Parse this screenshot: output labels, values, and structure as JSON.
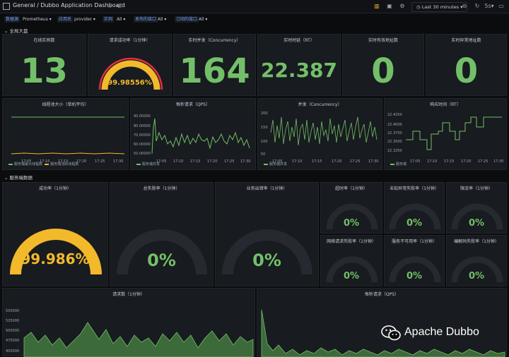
{
  "header": {
    "breadcrumb_root": "General",
    "breadcrumb_sep": "/",
    "title": "Dubbo Application Dashboard",
    "time_range": "Last 30 minutes",
    "refresh": "5s"
  },
  "variables": [
    {
      "label": "数据源",
      "value": "Prometheus ▾"
    },
    {
      "label": "应用名",
      "value": "provider ▾"
    },
    {
      "label": "实例",
      "value": "All ▾"
    },
    {
      "label": "发布的接口",
      "value": "All ▾"
    },
    {
      "label": "订阅的接口",
      "value": "All ▾"
    }
  ],
  "rows": {
    "global": "⌄ 全局大盘",
    "server": "⌄ 服务端数据"
  },
  "stats": {
    "online": {
      "title": "在线实例数",
      "value": "13"
    },
    "success_gauge": {
      "title": "请求成功率（1分钟）",
      "value": "99.98556%",
      "percent": 99.98556
    },
    "concurrency": {
      "title": "实时并发（Concurrency）",
      "value": "164"
    },
    "rt": {
      "title": "实时时延（RT）",
      "value": "22.387"
    },
    "valid_addr": {
      "title": "实时有效地址数",
      "value": "0"
    },
    "invalid_addr": {
      "title": "实时异常地址数",
      "value": "0"
    }
  },
  "timeseries": {
    "thread_pool": {
      "title": "线程池大小（单机平均）",
      "x_ticks": [
        "17:05",
        "17:10",
        "17:15",
        "17:20",
        "17:25",
        "17:30"
      ],
      "legend": [
        "服务端最大线程数",
        "服务端活跃线程数"
      ]
    },
    "qps": {
      "title": "每秒请求（QPS）",
      "y_ticks": [
        "90.00000",
        "80.00000",
        "70.00000",
        "60.00000",
        "50.00000"
      ],
      "x_ticks": [
        "17:05",
        "17:10",
        "17:15",
        "17:20",
        "17:25",
        "17:30"
      ],
      "legend": [
        "服务端并发"
      ]
    },
    "concurrency": {
      "title": "并发（Concurrency）",
      "y_ticks": [
        "200",
        "150",
        "100",
        "50"
      ],
      "x_ticks": [
        "17:05",
        "17:10",
        "17:15",
        "17:20",
        "17:25",
        "17:30"
      ],
      "legend": [
        "服务端并发"
      ]
    },
    "response_time": {
      "title": "响应时间（RT）",
      "y_ticks": [
        "22.4250",
        "22.4000",
        "22.3750",
        "22.3500",
        "22.3250"
      ],
      "x_ticks": [
        "17:05",
        "17:10",
        "17:15",
        "17:20",
        "17:25",
        "17:30"
      ],
      "legend": [
        "服务端"
      ]
    }
  },
  "server_gauges": {
    "success": {
      "title": "成功率（1分钟）",
      "value": "99.986%",
      "percent": 99.986
    },
    "total_fail": {
      "title": "总失败率（1分钟）",
      "value": "0%",
      "percent": 0
    },
    "biz_fail": {
      "title": "业务出错率（1分钟）",
      "value": "0%",
      "percent": 0
    },
    "timeout": {
      "title": "超时率（1分钟）",
      "value": "0%",
      "percent": 0
    },
    "unknown": {
      "title": "未知异常失败率（1分钟）",
      "value": "0%",
      "percent": 0
    },
    "limit": {
      "title": "限流率（1分钟）",
      "value": "0%",
      "percent": 0
    },
    "network": {
      "title": "网络请求失败率（1分钟）",
      "value": "0%",
      "percent": 0
    },
    "unavailable": {
      "title": "服务不可用率（1分钟）",
      "value": "0%",
      "percent": 0
    },
    "codec": {
      "title": "编解码失败率（1分钟）",
      "value": "0%",
      "percent": 0
    }
  },
  "bottom": {
    "requests": {
      "title": "请求数（1分钟）",
      "y_ticks": [
        "550000",
        "525000",
        "500000",
        "475000",
        "450000"
      ]
    },
    "qps": {
      "title": "每秒请求（QPS）"
    }
  },
  "watermark": "Apache Dubbo",
  "colors": {
    "green": "#73bf69",
    "yellow": "#f2b92b",
    "track": "#26292f",
    "red": "#e02f44"
  }
}
